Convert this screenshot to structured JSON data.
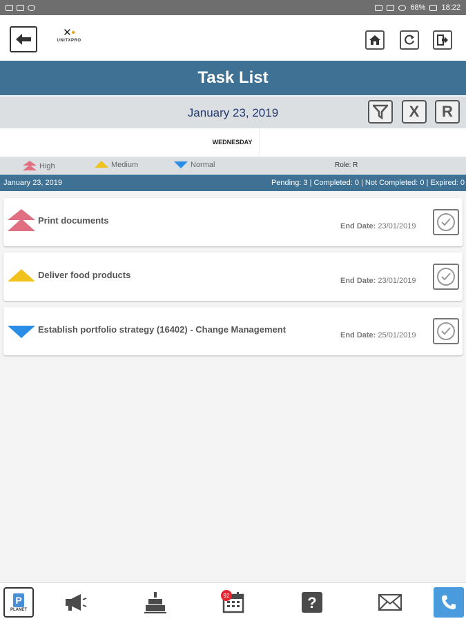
{
  "status_bar": {
    "battery": "68%",
    "time": "18:22"
  },
  "header": {
    "back_icon": "arrow-left-icon",
    "logo_text": "UNITXPRO",
    "home_icon": "home-icon",
    "refresh_icon": "refresh-icon",
    "logout_icon": "logout-icon"
  },
  "title": "Task List",
  "date_bar": {
    "date": "January 23, 2019",
    "filter_icon": "filter-icon",
    "clear_label": "X",
    "reset_label": "R"
  },
  "weekday": "WEDNESDAY",
  "legend": {
    "high": "High",
    "medium": "Medium",
    "normal": "Normal",
    "role": "Role:  R"
  },
  "colors": {
    "high": "#e07081",
    "medium": "#f1c21b",
    "normal": "#2a8de6",
    "accent": "#3e7193"
  },
  "summary": {
    "date": "January 23, 2019",
    "counts": "Pending: 3 | Completed: 0 | Not Completed: 0 | Expired: 0"
  },
  "tasks": [
    {
      "priority": "high",
      "title": "Print documents",
      "end_label": "End Date:",
      "end_date": "23/01/2019"
    },
    {
      "priority": "medium",
      "title": "Deliver food products",
      "end_label": "End Date:",
      "end_date": "23/01/2019"
    },
    {
      "priority": "normal",
      "title": "Establish portfolio strategy (16402) - Change Management",
      "end_label": "End Date:",
      "end_date": "25/01/2019"
    }
  ],
  "bottom_nav": {
    "planet_letter": "P",
    "planet_label": "PLANET",
    "calendar_badge": "92",
    "icons": [
      "planet-icon",
      "megaphone-icon",
      "birthday-cake-icon",
      "calendar-icon",
      "help-icon",
      "mail-icon",
      "phone-icon"
    ]
  }
}
